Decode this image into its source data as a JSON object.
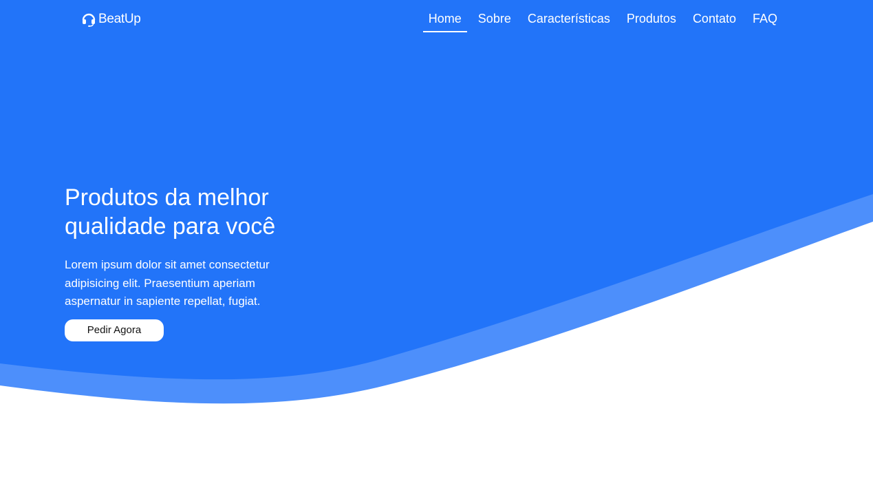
{
  "brand": {
    "name": "BeatUp",
    "icon": "headset-icon"
  },
  "nav": {
    "items": [
      {
        "label": "Home",
        "active": true
      },
      {
        "label": "Sobre",
        "active": false
      },
      {
        "label": "Características",
        "active": false
      },
      {
        "label": "Produtos",
        "active": false
      },
      {
        "label": "Contato",
        "active": false
      },
      {
        "label": "FAQ",
        "active": false
      }
    ]
  },
  "hero": {
    "title": "Produtos da melhor qualidade para você",
    "text": "Lorem ipsum dolor sit amet consectetur adipisicing elit. Praesentium aperiam aspernatur in sapiente repellat, fugiat.",
    "button_label": "Pedir Agora"
  },
  "colors": {
    "primary": "#2274f9",
    "wave_light": "#4d8ffb",
    "white": "#ffffff"
  }
}
